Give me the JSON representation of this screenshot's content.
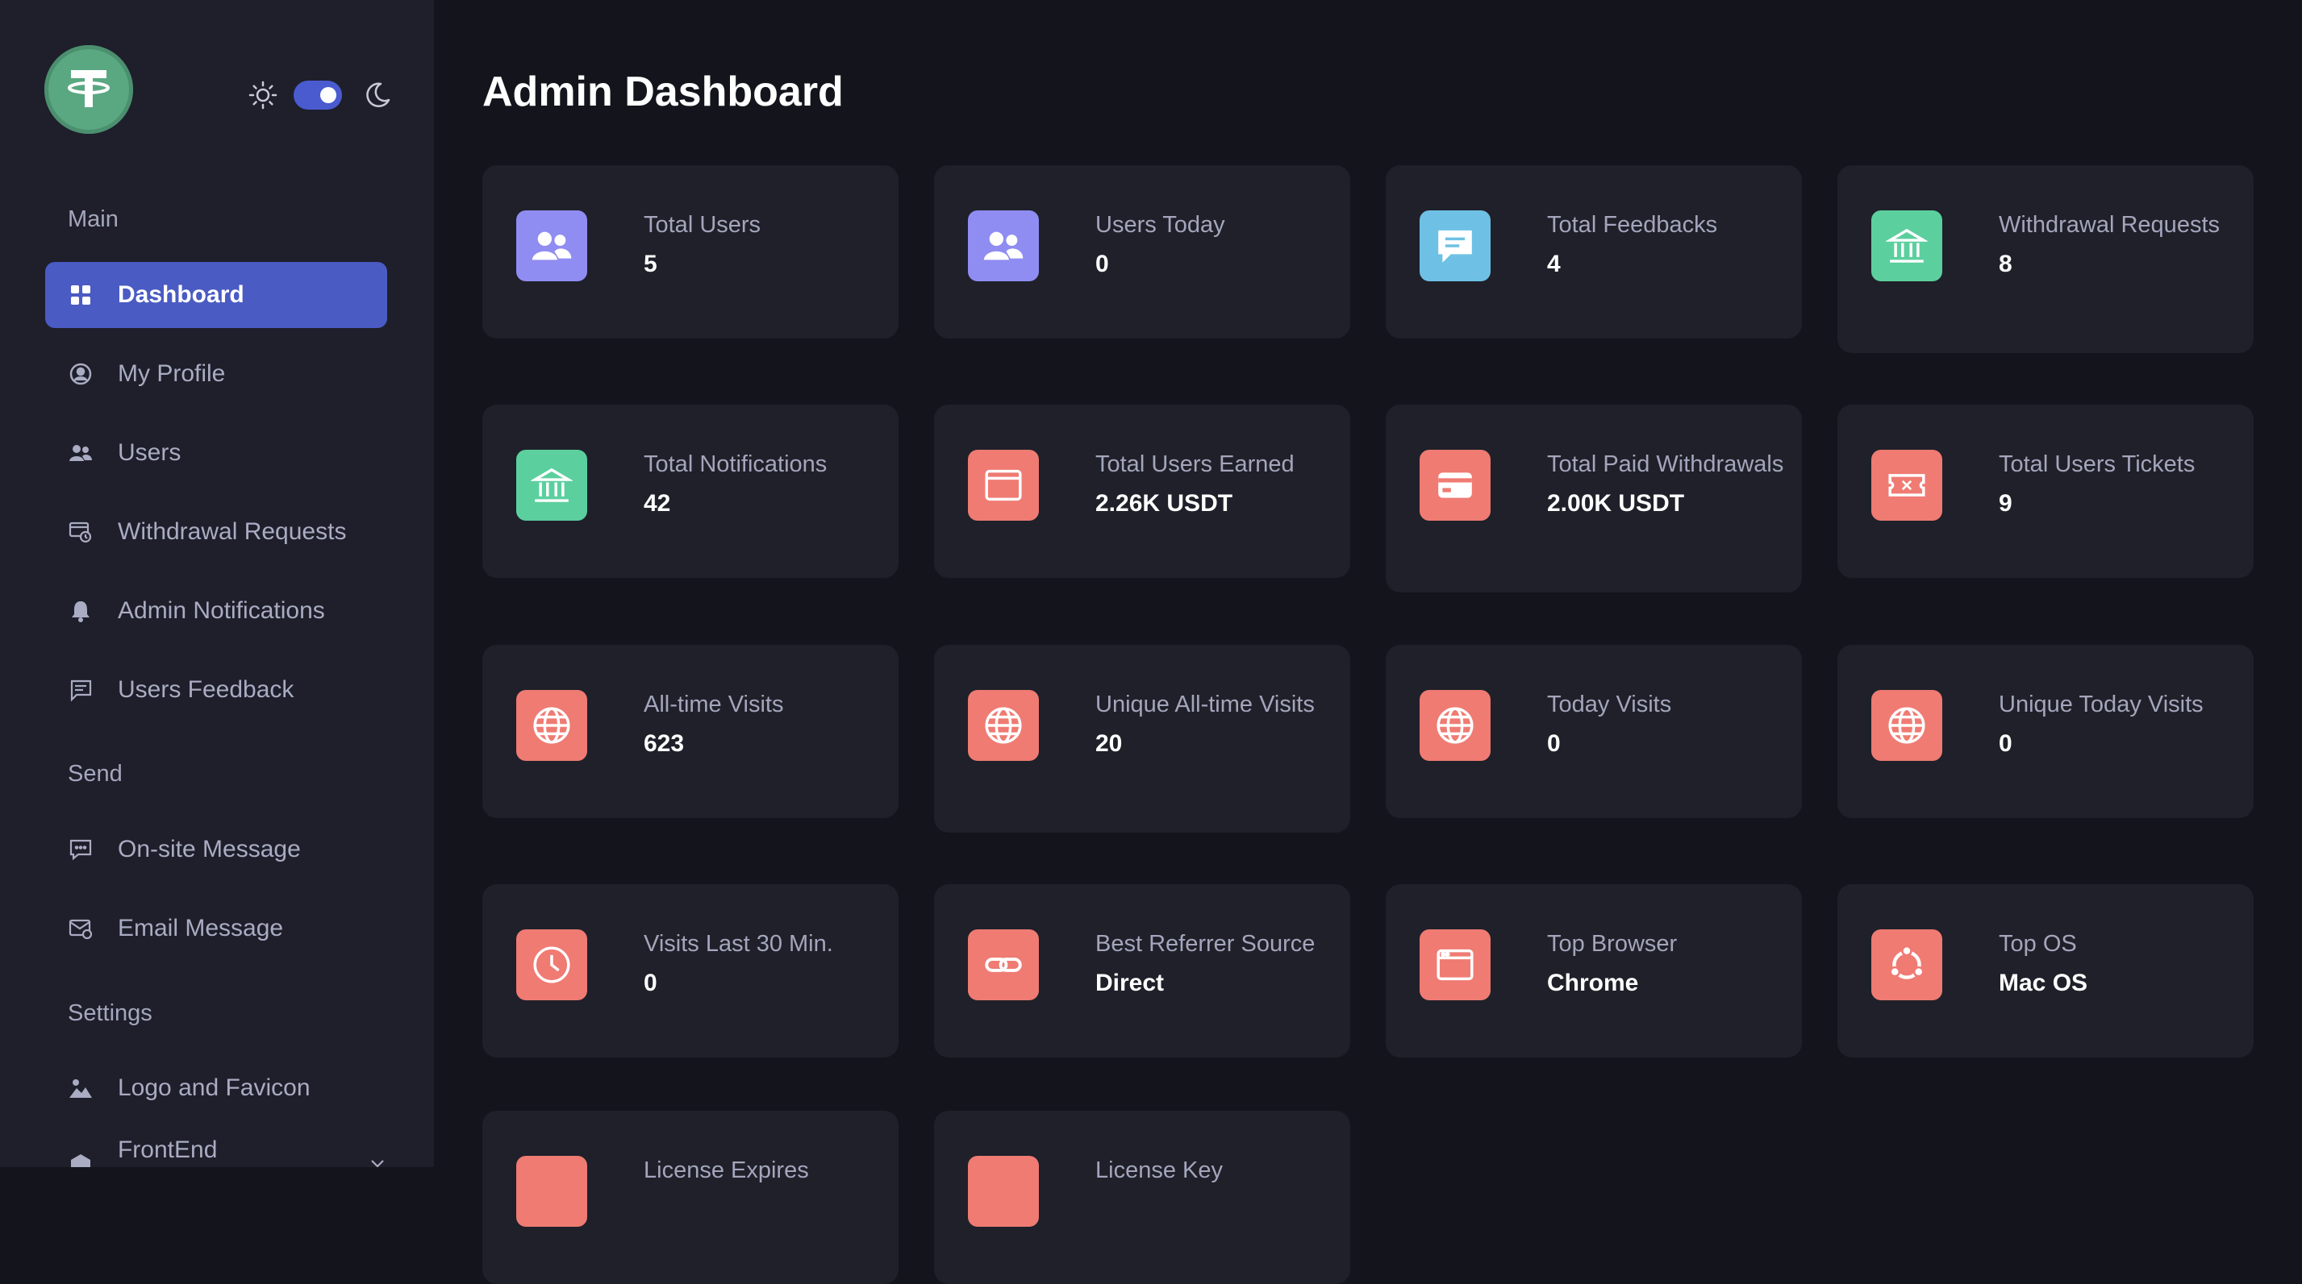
{
  "sidebar": {
    "logo_icon": "tether-logo",
    "theme_toggle": {
      "light_icon": "sun-icon",
      "dark_icon": "moon-icon",
      "state": "dark"
    },
    "sections": [
      "Main",
      "Send",
      "Settings"
    ],
    "items": [
      {
        "label": "Dashboard",
        "icon": "dashboard-icon",
        "active": true
      },
      {
        "label": "My Profile",
        "icon": "user-circle-icon"
      },
      {
        "label": "Users",
        "icon": "users-icon"
      },
      {
        "label": "Withdrawal Requests",
        "icon": "withdrawal-icon"
      },
      {
        "label": "Admin Notifications",
        "icon": "bell-icon"
      },
      {
        "label": "Users Feedback",
        "icon": "feedback-icon"
      },
      {
        "label": "On-site Message",
        "icon": "message-icon"
      },
      {
        "label": "Email Message",
        "icon": "email-icon"
      },
      {
        "label": "Logo and Favicon",
        "icon": "image-icon"
      },
      {
        "label": "FrontEnd Manager",
        "icon": "frontend-icon"
      }
    ]
  },
  "main": {
    "title": "Admin Dashboard",
    "cards": [
      {
        "label": "Total Users",
        "value": "5",
        "icon": "users-icon",
        "color": "#8f8cf2"
      },
      {
        "label": "Users Today",
        "value": "0",
        "icon": "users-icon",
        "color": "#8f8cf2"
      },
      {
        "label": "Total Feedbacks",
        "value": "4",
        "icon": "chat-icon",
        "color": "#6ec1e4"
      },
      {
        "label": "Withdrawal Requests",
        "value": "8",
        "icon": "bank-icon",
        "color": "#5ccf9e"
      },
      {
        "label": "Total Notifications",
        "value": "42",
        "icon": "bank-icon",
        "color": "#5ccf9e"
      },
      {
        "label": "Total Users Earned",
        "value": "2.26K USDT",
        "icon": "wallet-icon",
        "color": "#ef7b73"
      },
      {
        "label": "Total Paid Withdrawals",
        "value": "2.00K USDT",
        "icon": "card-icon",
        "color": "#ef7b73"
      },
      {
        "label": "Total Users Tickets",
        "value": "9",
        "icon": "ticket-icon",
        "color": "#ef7b73"
      },
      {
        "label": "All-time Visits",
        "value": "623",
        "icon": "globe-icon",
        "color": "#ef7b73"
      },
      {
        "label": "Unique All-time Visits",
        "value": "20",
        "icon": "globe-icon",
        "color": "#ef7b73"
      },
      {
        "label": "Today Visits",
        "value": "0",
        "icon": "globe-icon",
        "color": "#ef7b73"
      },
      {
        "label": "Unique Today Visits",
        "value": "0",
        "icon": "globe-icon",
        "color": "#ef7b73"
      },
      {
        "label": "Visits Last 30 Min.",
        "value": "0",
        "icon": "clock-icon",
        "color": "#ef7b73"
      },
      {
        "label": "Best Referrer Source",
        "value": "Direct",
        "icon": "link-icon",
        "color": "#ef7b73"
      },
      {
        "label": "Top Browser",
        "value": "Chrome",
        "icon": "browser-icon",
        "color": "#ef7b73"
      },
      {
        "label": "Top OS",
        "value": "Mac OS",
        "icon": "ubuntu-icon",
        "color": "#ef7b73"
      },
      {
        "label": "License Expires",
        "value": "",
        "icon": "license-icon",
        "color": "#ef7b73"
      },
      {
        "label": "License Key",
        "value": "",
        "icon": "key-icon",
        "color": "#ef7b73"
      }
    ]
  }
}
